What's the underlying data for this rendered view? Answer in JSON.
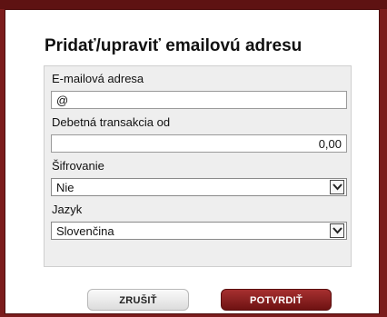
{
  "dialog": {
    "title": "Pridať/upraviť emailovú adresu"
  },
  "form": {
    "email_label": "E-mailová adresa",
    "email_value": "@",
    "debit_label": "Debetná transakcia od",
    "debit_value": "0,00",
    "encryption_label": "Šifrovanie",
    "encryption_selected": "Nie",
    "language_label": "Jazyk",
    "language_selected": "Slovenčina"
  },
  "buttons": {
    "cancel_label": "ZRUŠIŤ",
    "confirm_label": "POTVRDIŤ"
  },
  "colors": {
    "frame": "#7b1c1c",
    "confirm_button": "#8b1a1a"
  },
  "icons": [
    "chevron-down-icon"
  ]
}
